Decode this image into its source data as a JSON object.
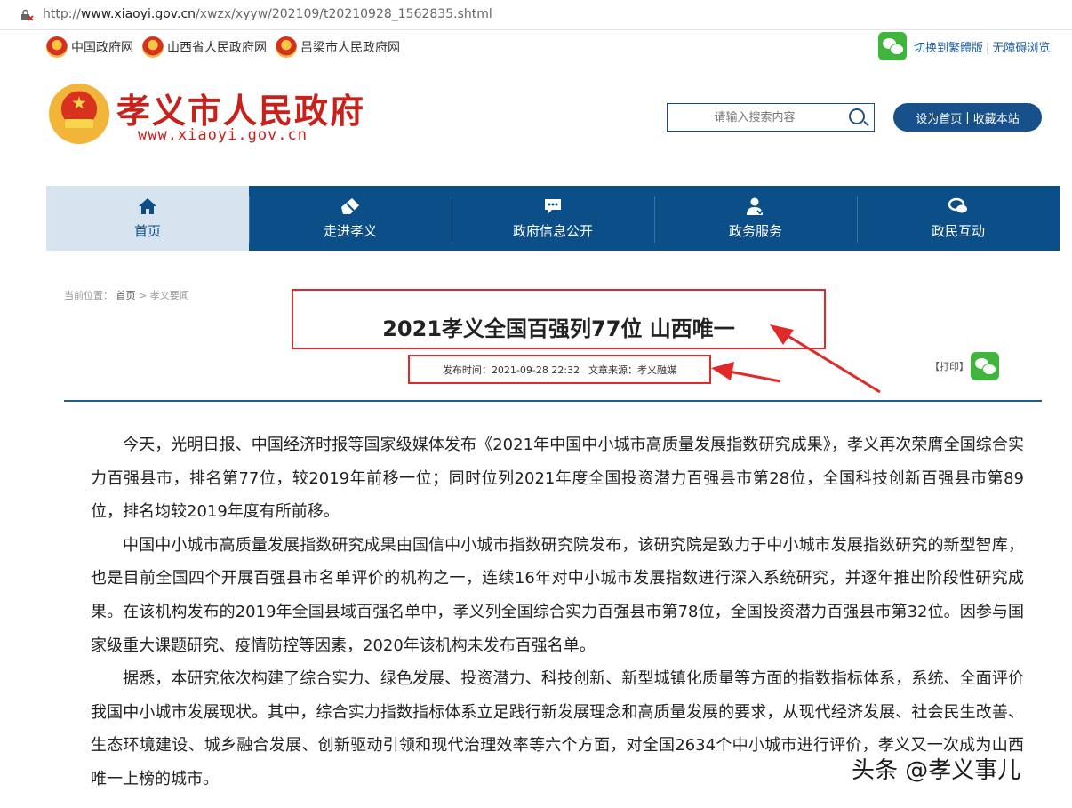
{
  "address_bar": {
    "url_prefix": "http://",
    "url_host": "www.xiaoyi.gov.cn",
    "url_path": "/xwzx/xyyw/202109/t20210928_1562835.shtml"
  },
  "top_links": [
    {
      "label": "中国政府网"
    },
    {
      "label": "山西省人民政府网"
    },
    {
      "label": "吕梁市人民政府网"
    }
  ],
  "top_right": {
    "traditional": "切换到繁體版",
    "separator": "|",
    "accessible": "无障碍浏览"
  },
  "header": {
    "site_name": "孝义市人民政府",
    "domain": "www.xiaoyi.gov.cn"
  },
  "search": {
    "placeholder": "请输入搜索内容"
  },
  "home_buttons": {
    "set_home": "设为首页",
    "separator": "|",
    "bookmark": "收藏本站"
  },
  "nav": [
    {
      "label": "首页",
      "icon": "home-icon",
      "active": true
    },
    {
      "label": "走进孝义",
      "icon": "eraser-icon"
    },
    {
      "label": "政府信息公开",
      "icon": "message-icon"
    },
    {
      "label": "政务服务",
      "icon": "user-service-icon"
    },
    {
      "label": "政民互动",
      "icon": "chat-icon"
    }
  ],
  "breadcrumb": {
    "prefix": "当前位置：",
    "home": "首页",
    "sep": ">",
    "section": "孝义要闻"
  },
  "article": {
    "title": "2021孝义全国百强列77位 山西唯一",
    "publish_label": "发布时间：",
    "publish_time": "2021-09-28 22:32",
    "source_label": "文章来源：",
    "source": "孝义融媒",
    "print": "【打印】",
    "paragraphs": [
      "今天，光明日报、中国经济时报等国家级媒体发布《2021年中国中小城市高质量发展指数研究成果》，孝义再次荣膺全国综合实力百强县市，排名第77位，较2019年前移一位；同时位列2021年度全国投资潜力百强县市第28位，全国科技创新百强县市第89位，排名均较2019年度有所前移。",
      "中国中小城市高质量发展指数研究成果由国信中小城市指数研究院发布，该研究院是致力于中小城市发展指数研究的新型智库，也是目前全国四个开展百强县市名单评价的机构之一，连续16年对中小城市发展指数进行深入系统研究，并逐年推出阶段性研究成果。在该机构发布的2019年全国县域百强名单中，孝义列全国综合实力百强县市第78位，全国投资潜力百强县市第32位。因参与国家级重大课题研究、疫情防控等因素，2020年该机构未发布百强名单。",
      "据悉，本研究依次构建了综合实力、绿色发展、投资潜力、科技创新、新型城镇化质量等方面的指数指标体系，系统、全面评价我国中小城市发展现状。其中，综合实力指数指标体系立足践行新发展理念和高质量发展的要求，从现代经济发展、社会民生改善、生态环境建设、城乡融合发展、创新驱动引领和现代治理效率等六个方面，对全国2634个中小城市进行评价，孝义又一次成为山西唯一上榜的城市。"
    ]
  },
  "watermark": "头条 @孝义事儿",
  "colors": {
    "nav_bg": "#0c4f88",
    "nav_active_bg": "#d7e4ef",
    "brand_red": "#c8201a",
    "annotation_red": "#e02a2a"
  }
}
